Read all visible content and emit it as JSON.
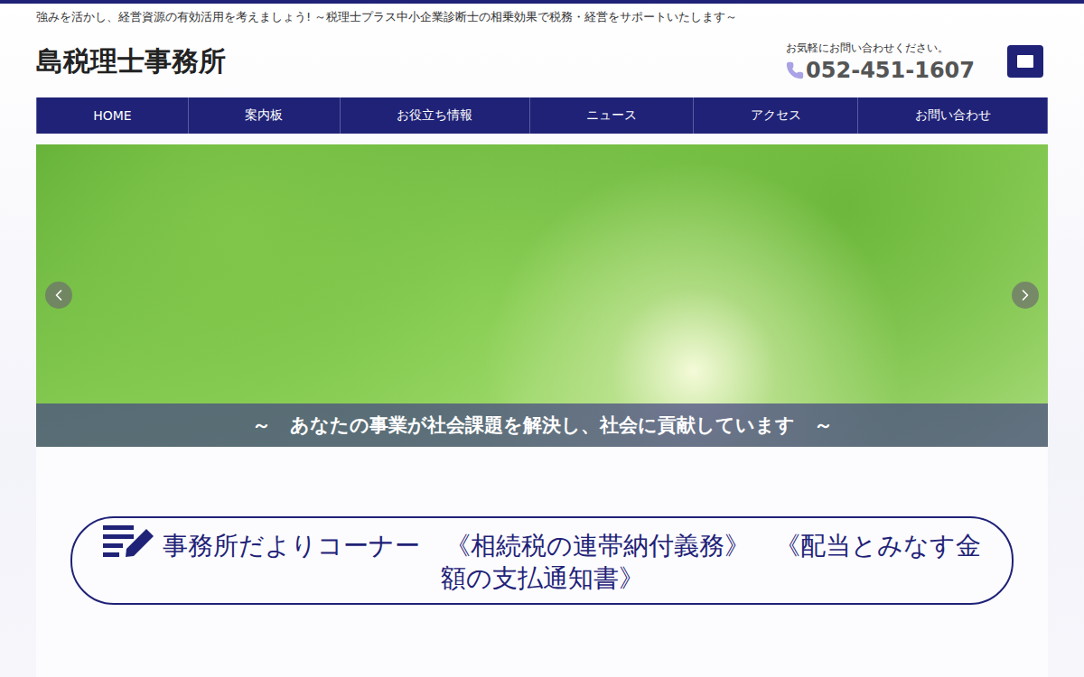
{
  "tagline": "強みを活かし、経営資源の有効活用を考えましょう! ～税理士プラス中小企業診断士の相乗効果で税務・経営をサポートいたします～",
  "site_title": "島税理士事務所",
  "contact": {
    "note": "お気軽にお問い合わせください。",
    "phone": "052-451-1607"
  },
  "nav": [
    {
      "label": "HOME",
      "selected": false
    },
    {
      "label": "案内板",
      "selected": false
    },
    {
      "label": "お役立ち情報",
      "selected": false
    },
    {
      "label": "ニュース",
      "selected": false
    },
    {
      "label": "アクセス",
      "selected": false
    },
    {
      "label": "お問い合わせ",
      "selected": false
    }
  ],
  "slider": {
    "caption": "～　あなたの事業が社会課題を解決し、社会に貢献しています　～"
  },
  "news_heading": "事務所だよりコーナー　《相続税の連帯納付義務》　《配当とみなす金額の支払通知書》"
}
